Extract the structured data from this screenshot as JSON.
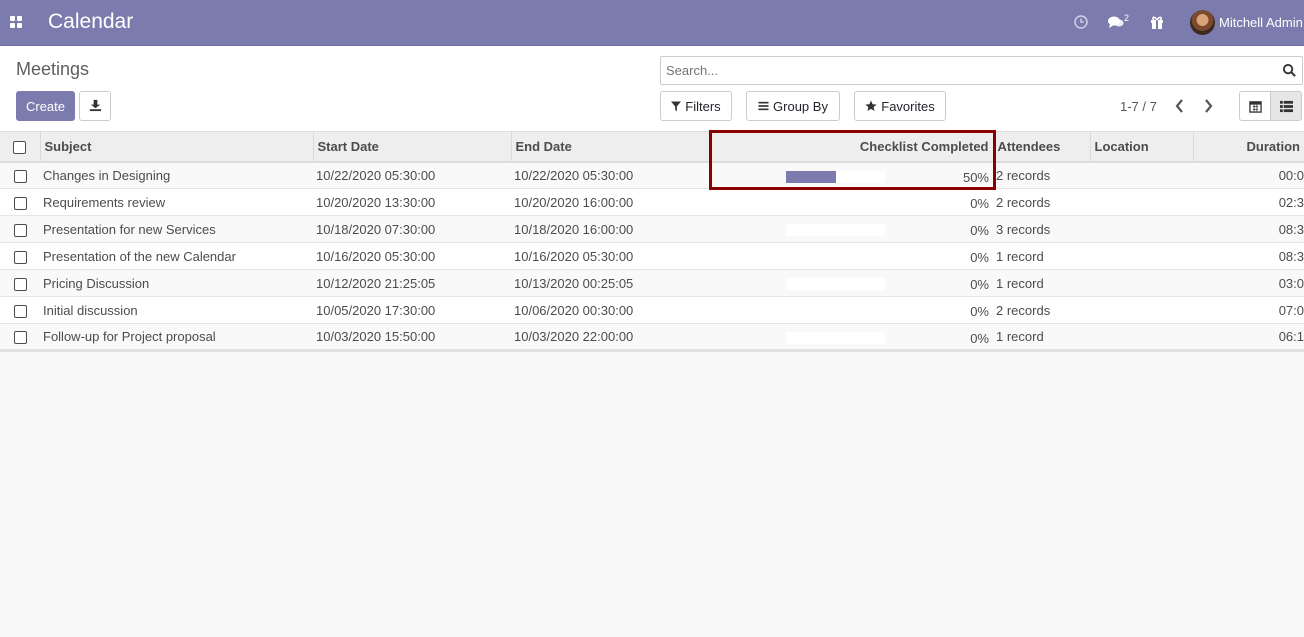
{
  "navbar": {
    "app_title": "Calendar",
    "chat_count": "2",
    "user_name": "Mitchell Admin",
    "brand_color": "#7c7bad"
  },
  "control_panel": {
    "breadcrumb": "Meetings",
    "create_label": "Create",
    "search_placeholder": "Search...",
    "filters_label": "Filters",
    "group_by_label": "Group By",
    "favorites_label": "Favorites",
    "pager_value": "1-7 / 7"
  },
  "table": {
    "headers": {
      "subject": "Subject",
      "start_date": "Start Date",
      "end_date": "End Date",
      "checklist": "Checklist Completed",
      "attendees": "Attendees",
      "location": "Location",
      "duration": "Duration"
    },
    "rows": [
      {
        "subject": "Changes in Designing",
        "start": "10/22/2020 05:30:00",
        "end": "10/22/2020 05:30:00",
        "checklist": "50%",
        "checklist_fraction": 0.5,
        "attendees": "2 records",
        "location": "",
        "duration": "00:0"
      },
      {
        "subject": "Requirements review",
        "start": "10/20/2020 13:30:00",
        "end": "10/20/2020 16:00:00",
        "checklist": "0%",
        "checklist_fraction": 0,
        "attendees": "2 records",
        "location": "",
        "duration": "02:3"
      },
      {
        "subject": "Presentation for new Services",
        "start": "10/18/2020 07:30:00",
        "end": "10/18/2020 16:00:00",
        "checklist": "0%",
        "checklist_fraction": 0,
        "attendees": "3 records",
        "location": "",
        "duration": "08:3"
      },
      {
        "subject": "Presentation of the new Calendar",
        "start": "10/16/2020 05:30:00",
        "end": "10/16/2020 05:30:00",
        "checklist": "0%",
        "checklist_fraction": 0,
        "attendees": "1 record",
        "location": "",
        "duration": "08:3"
      },
      {
        "subject": "Pricing Discussion",
        "start": "10/12/2020 21:25:05",
        "end": "10/13/2020 00:25:05",
        "checklist": "0%",
        "checklist_fraction": 0,
        "attendees": "1 record",
        "location": "",
        "duration": "03:0"
      },
      {
        "subject": "Initial discussion",
        "start": "10/05/2020 17:30:00",
        "end": "10/06/2020 00:30:00",
        "checklist": "0%",
        "checklist_fraction": 0,
        "attendees": "2 records",
        "location": "",
        "duration": "07:0"
      },
      {
        "subject": "Follow-up for Project proposal",
        "start": "10/03/2020 15:50:00",
        "end": "10/03/2020 22:00:00",
        "checklist": "0%",
        "checklist_fraction": 0,
        "attendees": "1 record",
        "location": "",
        "duration": "06:1"
      }
    ]
  }
}
